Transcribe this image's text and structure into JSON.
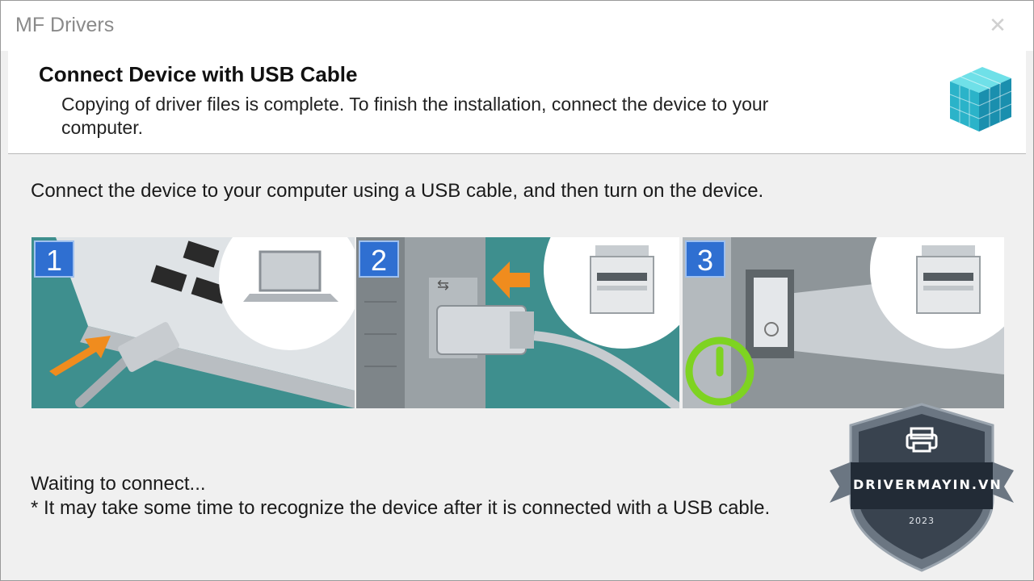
{
  "window": {
    "title": "MF Drivers",
    "close_symbol": "✕"
  },
  "header": {
    "title": "Connect Device with USB Cable",
    "description": "Copying of driver files is complete. To finish the installation, connect the device to your computer."
  },
  "instruction": "Connect the device to your computer using a USB cable, and then turn on the device.",
  "steps": [
    {
      "number": "1",
      "icon": "laptop-usb-illustration"
    },
    {
      "number": "2",
      "icon": "printer-usb-port-illustration"
    },
    {
      "number": "3",
      "icon": "printer-power-switch-illustration"
    }
  ],
  "status": {
    "waiting": "Waiting to connect...",
    "note": "* It may take some time to recognize the device after it is connected with a USB cable."
  },
  "watermark": {
    "text": "DRIVERMAYIN.VN",
    "year": "2023",
    "icon": "printer-icon"
  },
  "colors": {
    "accent": "#2f6fd1",
    "arrow": "#f08c1e",
    "power": "#7ed321",
    "teal": "#3e8f8e"
  }
}
